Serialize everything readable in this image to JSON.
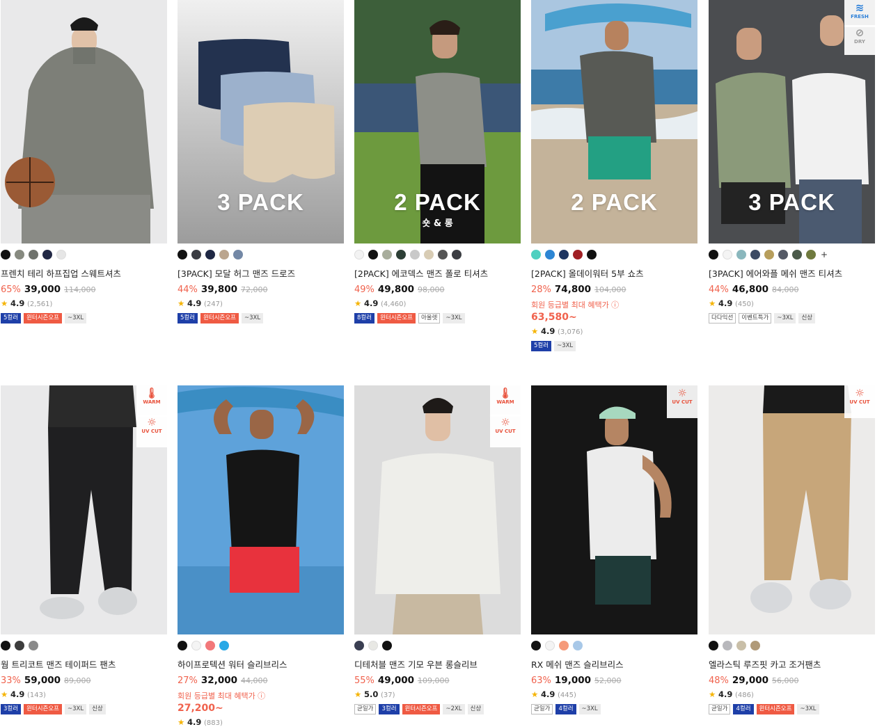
{
  "products": [
    {
      "name": "프렌치 테리 하프집업 스웨트셔츠",
      "disc": "65%",
      "sale": "39,000",
      "orig": "114,000",
      "rating": "4.9",
      "reviews": "(2,561)",
      "colors": [
        "#111111",
        "#878a80",
        "#6f726c",
        "#222845",
        "#e6e6e6"
      ],
      "tags": [
        {
          "t": "5컬러",
          "c": "blue"
        },
        {
          "t": "윈터시즌오프",
          "c": "red"
        },
        {
          "t": "~3XL",
          "c": "gray"
        }
      ]
    },
    {
      "name": "[3PACK] 모달 허그 맨즈 드로즈",
      "disc": "44%",
      "sale": "39,800",
      "orig": "72,000",
      "rating": "4.9",
      "reviews": "(247)",
      "pack": "3 PACK",
      "colors": [
        "#111111",
        "#3a3c42",
        "#1f2844",
        "#bba58e",
        "#7388a6"
      ],
      "tags": [
        {
          "t": "5컬러",
          "c": "blue"
        },
        {
          "t": "윈터시즌오프",
          "c": "red"
        },
        {
          "t": "~3XL",
          "c": "gray"
        }
      ]
    },
    {
      "name": "[2PACK] 에코덱스 맨즈 폴로 티셔츠",
      "disc": "49%",
      "sale": "49,800",
      "orig": "98,000",
      "rating": "4.9",
      "reviews": "(4,460)",
      "pack": "2 PACK",
      "packsub": "숏 & 롱",
      "colors": [
        "#f3f3f3",
        "#111111",
        "#a8ad9c",
        "#2d3f36",
        "#c9c9c9",
        "#d8ccb4",
        "#555555",
        "#3b3d42"
      ],
      "tags": [
        {
          "t": "8컬러",
          "c": "blue"
        },
        {
          "t": "윈터시즌오프",
          "c": "red"
        },
        {
          "t": "아울렛",
          "c": "plain"
        },
        {
          "t": "~3XL",
          "c": "gray"
        }
      ]
    },
    {
      "name": "[2PACK] 올데이워터 5부 쇼츠",
      "disc": "28%",
      "sale": "74,800",
      "orig": "104,000",
      "rating": "4.9",
      "reviews": "(3,076)",
      "pack": "2 PACK",
      "member": "회원 등급별 최대 혜택가 ⓘ",
      "memberprice": "63,580~",
      "colors": [
        "#4fd0c0",
        "#2d86d4",
        "#1d3561",
        "#a01f24",
        "#111111"
      ],
      "tags": [
        {
          "t": "5컬러",
          "c": "blue"
        },
        {
          "t": "~3XL",
          "c": "gray"
        }
      ]
    },
    {
      "name": "[3PACK] 에어와플 메쉬 맨즈 티셔츠",
      "disc": "44%",
      "sale": "46,800",
      "orig": "84,000",
      "rating": "4.9",
      "reviews": "(450)",
      "pack": "3 PACK",
      "plus": "+",
      "colors": [
        "#111111",
        "#f4f4f4",
        "#8ab7bd",
        "#3c4a63",
        "#b79e5c",
        "#555a66",
        "#4b5a4a",
        "#6f7a3e"
      ],
      "features": [
        "FRESH",
        "DRY"
      ],
      "tags": [
        {
          "t": "다다익선",
          "c": "plain"
        },
        {
          "t": "이벤트특가",
          "c": "plain"
        },
        {
          "t": "~3XL",
          "c": "gray"
        },
        {
          "t": "신상",
          "c": "gray"
        }
      ]
    },
    {
      "name": "웜 트리코트 맨즈 테이퍼드 팬츠",
      "disc": "33%",
      "sale": "59,000",
      "orig": "89,000",
      "rating": "4.9",
      "reviews": "(143)",
      "colors": [
        "#111111",
        "#3d3d3d",
        "#8a8a8a"
      ],
      "features": [
        "WARM",
        "UV CUT"
      ],
      "tags": [
        {
          "t": "3컬러",
          "c": "blue"
        },
        {
          "t": "윈터시즌오프",
          "c": "red"
        },
        {
          "t": "~3XL",
          "c": "gray"
        },
        {
          "t": "신상",
          "c": "gray"
        }
      ]
    },
    {
      "name": "하이프로텍션 워터 슬리브리스",
      "disc": "27%",
      "sale": "32,000",
      "orig": "44,000",
      "rating": "4.9",
      "reviews": "(883)",
      "member": "회원 등급별 최대 혜택가 ⓘ",
      "memberprice": "27,200~",
      "colors": [
        "#111111",
        "#f4f4f4",
        "#f2787a",
        "#27a8e6"
      ],
      "tags": []
    },
    {
      "name": "디테처블 맨즈 기모 우븐 롱슬리브",
      "disc": "55%",
      "sale": "49,000",
      "orig": "109,000",
      "rating": "5.0",
      "reviews": "(37)",
      "colors": [
        "#3a3f52",
        "#e8e8e4",
        "#111111"
      ],
      "features": [
        "WARM",
        "UV CUT"
      ],
      "tags": [
        {
          "t": "균일가",
          "c": "plain"
        },
        {
          "t": "3컬러",
          "c": "blue"
        },
        {
          "t": "윈터시즌오프",
          "c": "red"
        },
        {
          "t": "~2XL",
          "c": "gray"
        },
        {
          "t": "신상",
          "c": "gray"
        }
      ]
    },
    {
      "name": "RX 메쉬 맨즈 슬리브리스",
      "disc": "63%",
      "sale": "19,000",
      "orig": "52,000",
      "rating": "4.9",
      "reviews": "(445)",
      "colors": [
        "#111111",
        "#f4f4f4",
        "#f59a7a",
        "#a8c8e8"
      ],
      "features": [
        "UV CUT"
      ],
      "tags": [
        {
          "t": "균일가",
          "c": "plain"
        },
        {
          "t": "4컬러",
          "c": "blue"
        },
        {
          "t": "~3XL",
          "c": "gray"
        }
      ]
    },
    {
      "name": "엘라스틱 루즈핏 카고 조거팬츠",
      "disc": "48%",
      "sale": "29,000",
      "orig": "56,000",
      "rating": "4.9",
      "reviews": "(486)",
      "colors": [
        "#111111",
        "#b8b8bc",
        "#c9bfa8",
        "#b09a78"
      ],
      "features": [
        "UV CUT"
      ],
      "tags": [
        {
          "t": "균일가",
          "c": "plain"
        },
        {
          "t": "4컬러",
          "c": "blue"
        },
        {
          "t": "윈터시즌오프",
          "c": "red"
        },
        {
          "t": "~3XL",
          "c": "gray"
        }
      ]
    }
  ]
}
